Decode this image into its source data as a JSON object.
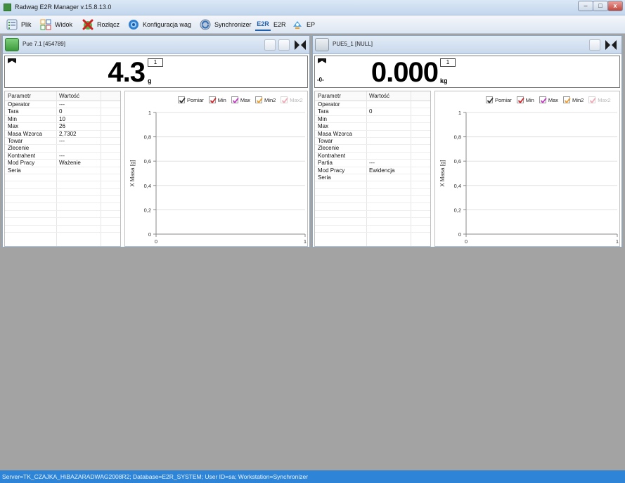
{
  "window": {
    "title": "Radwag E2R Manager v.15.8.13.0",
    "min_label": "–",
    "max_label": "□",
    "close_label": "x"
  },
  "menu": {
    "items": [
      {
        "label": "Plik",
        "icon": "file-list-icon"
      },
      {
        "label": "Widok",
        "icon": "grid-view-icon"
      },
      {
        "label": "Rozłącz",
        "icon": "disconnect-icon"
      },
      {
        "label": "Konfiguracja wag",
        "icon": "gear-icon"
      },
      {
        "label": "Synchronizer",
        "icon": "sync-icon"
      },
      {
        "label": "E2R",
        "icon": "e2r-logo-icon",
        "icon_text": "E2R"
      },
      {
        "label": "EP",
        "icon": "ep-icon"
      }
    ]
  },
  "colors": {
    "status_bar": "#2e85d8",
    "check_red": "#d6262b",
    "check_magenta": "#c63ec6",
    "check_orange": "#f0a030",
    "check_faded": "#f2a9b4"
  },
  "panels": [
    {
      "title": "Pue 7.1 [454789]",
      "display": {
        "value": "4.3",
        "unit": "g",
        "range": "1",
        "zero_indicator": ""
      },
      "table": {
        "headers": [
          "Parametr",
          "Wartość"
        ],
        "rows": [
          [
            "Operator",
            "---"
          ],
          [
            "Tara",
            "0"
          ],
          [
            "Min",
            "10"
          ],
          [
            "Max",
            "26"
          ],
          [
            "Masa Wzorca",
            "2,7302"
          ],
          [
            "Towar",
            "---"
          ],
          [
            "Zlecenie",
            ""
          ],
          [
            "Kontrahent",
            "---"
          ],
          [
            "Mod Pracy",
            "Ważenie"
          ],
          [
            "Seria",
            ""
          ]
        ]
      },
      "legend": [
        {
          "label": "Pomiar",
          "checked": true,
          "color": "#333333"
        },
        {
          "label": "Min",
          "checked": true,
          "color": "#d6262b"
        },
        {
          "label": "Max",
          "checked": true,
          "color": "#c63ec6"
        },
        {
          "label": "Min2",
          "checked": true,
          "color": "#f0a030"
        },
        {
          "label": "Max2",
          "checked": true,
          "color": "#f2a9b4",
          "faded": true
        }
      ]
    },
    {
      "title": "PUE5_1 [NULL]",
      "display": {
        "value": "0.000",
        "unit": "kg",
        "range": "1",
        "zero_indicator": "-0-"
      },
      "table": {
        "headers": [
          "Parametr",
          "Wartość"
        ],
        "rows": [
          [
            "Operator",
            ""
          ],
          [
            "Tara",
            "0"
          ],
          [
            "Min",
            ""
          ],
          [
            "Max",
            ""
          ],
          [
            "Masa Wzorca",
            ""
          ],
          [
            "Towar",
            ""
          ],
          [
            "Zlecenie",
            ""
          ],
          [
            "Kontrahent",
            ""
          ],
          [
            "Partia",
            "---"
          ],
          [
            "Mod Pracy",
            "Ewidencja"
          ],
          [
            "Seria",
            ""
          ]
        ]
      },
      "legend": [
        {
          "label": "Pomiar",
          "checked": true,
          "color": "#333333"
        },
        {
          "label": "Min",
          "checked": true,
          "color": "#d6262b"
        },
        {
          "label": "Max",
          "checked": true,
          "color": "#c63ec6"
        },
        {
          "label": "Min2",
          "checked": true,
          "color": "#f0a030"
        },
        {
          "label": "Max2",
          "checked": true,
          "color": "#f2a9b4",
          "faded": true
        }
      ]
    }
  ],
  "chart_data": [
    {
      "type": "line",
      "title": "",
      "xlabel": "",
      "ylabel": "X Masa [g]",
      "xlim": [
        0,
        1
      ],
      "ylim": [
        0,
        1
      ],
      "x_ticks": [
        "0",
        "1"
      ],
      "y_ticks": [
        "0",
        "0,2",
        "0,4",
        "0,6",
        "0,8",
        "1"
      ],
      "grid": true,
      "legend_position": "top",
      "series": [
        {
          "name": "Pomiar",
          "values": []
        },
        {
          "name": "Min",
          "values": []
        },
        {
          "name": "Max",
          "values": []
        },
        {
          "name": "Min2",
          "values": []
        },
        {
          "name": "Max2",
          "values": []
        }
      ]
    },
    {
      "type": "line",
      "title": "",
      "xlabel": "",
      "ylabel": "X Masa [g]",
      "xlim": [
        0,
        1
      ],
      "ylim": [
        0,
        1
      ],
      "x_ticks": [
        "0",
        "1"
      ],
      "y_ticks": [
        "0",
        "0,2",
        "0,4",
        "0,6",
        "0,8",
        "1"
      ],
      "grid": true,
      "legend_position": "top",
      "series": [
        {
          "name": "Pomiar",
          "values": []
        },
        {
          "name": "Min",
          "values": []
        },
        {
          "name": "Max",
          "values": []
        },
        {
          "name": "Min2",
          "values": []
        },
        {
          "name": "Max2",
          "values": []
        }
      ]
    }
  ],
  "status": {
    "text": "Server=TK_CZAJKA_H\\BAZARADWAG2008R2; Database=E2R_SYSTEM; User ID=sa; Workstation=Synchronizer"
  }
}
